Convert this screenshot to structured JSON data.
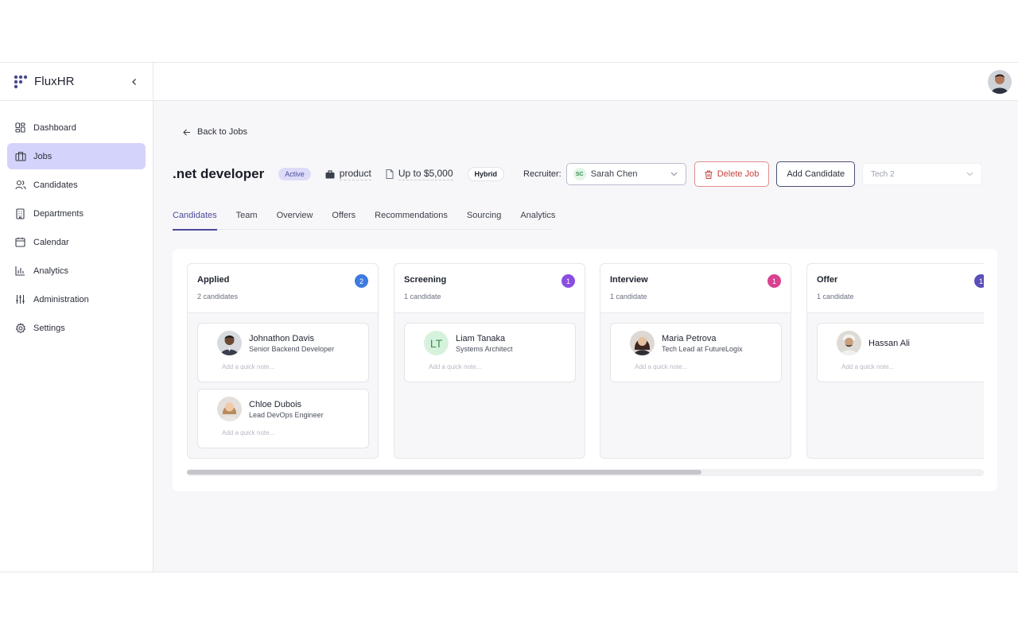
{
  "sidebar": {
    "brand": "FluxHR",
    "items": [
      {
        "label": "Dashboard",
        "icon": "grid-icon"
      },
      {
        "label": "Jobs",
        "icon": "briefcase-icon",
        "active": true
      },
      {
        "label": "Candidates",
        "icon": "users-icon"
      },
      {
        "label": "Departments",
        "icon": "building-icon"
      },
      {
        "label": "Calendar",
        "icon": "calendar-icon"
      },
      {
        "label": "Analytics",
        "icon": "bar-chart-icon"
      },
      {
        "label": "Administration",
        "icon": "sliders-icon"
      },
      {
        "label": "Settings",
        "icon": "gear-icon"
      }
    ]
  },
  "header": {
    "back_label": "Back to Jobs",
    "job_title": ".net developer",
    "status": "Active",
    "department": "product",
    "salary": "Up to $5,000",
    "work_mode": "Hybrid",
    "recruiter_label": "Recruiter:",
    "recruiter_initials": "SC",
    "recruiter_name": "Sarah Chen",
    "delete_label": "Delete Job",
    "add_candidate_label": "Add Candidate",
    "tech_select_value": "Tech 2"
  },
  "tabs": [
    "Candidates",
    "Team",
    "Overview",
    "Offers",
    "Recommendations",
    "Sourcing",
    "Analytics"
  ],
  "active_tab": "Candidates",
  "pipeline": {
    "columns": [
      {
        "title": "Applied",
        "count": "2",
        "subtitle": "2 candidates",
        "color": "#3d7be0",
        "cards": [
          {
            "name": "Johnathon Davis",
            "role": "Senior Backend Developer",
            "note_placeholder": "Add a quick note..."
          },
          {
            "name": "Chloe Dubois",
            "role": "Lead DevOps Engineer",
            "note_placeholder": "Add a quick note..."
          }
        ]
      },
      {
        "title": "Screening",
        "count": "1",
        "subtitle": "1 candidate",
        "color": "#8a4fe0",
        "cards": [
          {
            "name": "Liam Tanaka",
            "role": "Systems Architect",
            "initials": "LT",
            "note_placeholder": "Add a quick note..."
          }
        ]
      },
      {
        "title": "Interview",
        "count": "1",
        "subtitle": "1 candidate",
        "color": "#d9418f",
        "cards": [
          {
            "name": "Maria Petrova",
            "role": "Tech Lead at FutureLogix",
            "note_placeholder": "Add a quick note..."
          }
        ]
      },
      {
        "title": "Offer",
        "count": "1",
        "subtitle": "1 candidate",
        "color": "#5a4fb8",
        "cards": [
          {
            "name": "Hassan Ali",
            "role": "",
            "note_placeholder": "Add a quick note..."
          }
        ]
      }
    ]
  },
  "scroll_position_fraction": 0
}
